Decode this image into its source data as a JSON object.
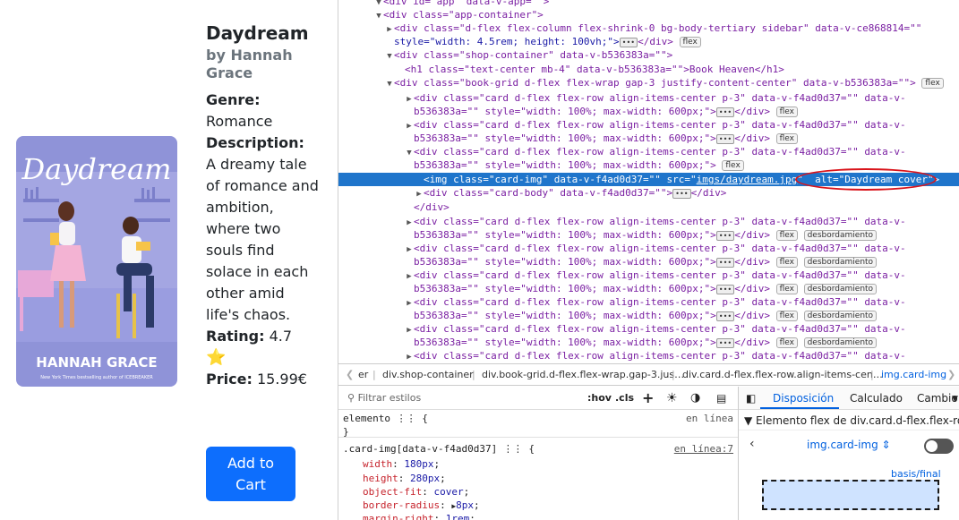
{
  "book": {
    "title": "Daydream",
    "author": "by Hannah Grace",
    "genre_label": "Genre:",
    "genre": "Romance",
    "description_label": "Description:",
    "description": "A dreamy tale of romance and ambition, where two souls find solace in each other amid life's chaos.",
    "rating_label": "Rating:",
    "rating": "4.7",
    "star": "⭐",
    "price_label": "Price:",
    "price": "15.99€",
    "button": "Add to Cart",
    "cover": {
      "title_script": "Daydream",
      "author": "HANNAH GRACE",
      "tagline": "New York Times bestselling author of ICEBREAKER"
    }
  },
  "devtools": {
    "tree_lines": [
      "<div id=\"app\" data-v-app=\"\">",
      "<div class=\"app-container\">",
      "<div class=\"d-flex flex-column flex-shrink-0 bg-body-tertiary sidebar\" data-v-ce868814=\"\"",
      "style=\"width: 4.5rem; height: 100vh;\">",
      "</div>",
      "<div class=\"shop-container\" data-v-b536383a=\"\">",
      "<h1 class=\"text-center mb-4\" data-v-b536383a=\"\">Book Heaven</h1>",
      "<div class=\"book-grid d-flex flex-wrap gap-3 justify-content-center\" data-v-b536383a=\"\">",
      "<div class=\"card d-flex flex-row align-items-center p-3\" data-v-f4ad0d37=\"\" data-v-",
      "b536383a=\"\" style=\"width: 100%; max-width: 600px;\">",
      "</div>",
      "<img class=\"card-img\" data-v-f4ad0d37=\"\" src=\"",
      "imgs/daydream.jpg",
      "alt=\"Daydream cover\">",
      "<div class=\"card-body\" data-v-f4ad0d37=\"\">",
      "</div>"
    ],
    "badge_flex": "flex",
    "badge_desb": "desbordamiento",
    "ellipsis": "•••",
    "breadcrumb": [
      "er",
      "div.shop-container",
      "div.book-grid.d-flex.flex-wrap.gap-3.jus…",
      "div.card.d-flex.flex-row.align-items-cen…",
      "img.card-img"
    ],
    "filter_placeholder": "Filtrar estilos",
    "toolbar": {
      "hov": ":hov",
      "cls": ".cls",
      "add": "+"
    },
    "rules": {
      "element_selector": "elemento",
      "element_source": "en línea",
      "card_selector": ".card-img[data-v-f4ad0d37]",
      "card_source": "en línea:7",
      "props": [
        {
          "name": "width",
          "value": "180px"
        },
        {
          "name": "height",
          "value": "280px"
        },
        {
          "name": "object-fit",
          "value": "cover"
        },
        {
          "name": "border-radius",
          "value": "8px"
        },
        {
          "name": "margin-right",
          "value": "1rem"
        }
      ]
    },
    "layout": {
      "tabs": [
        "Disposición",
        "Calculado",
        "Cambio"
      ],
      "flex_header": "Elemento flex de div.card.d-flex.flex-ro…",
      "flex_item": "img.card-img",
      "basis_label": "basis/final"
    }
  }
}
